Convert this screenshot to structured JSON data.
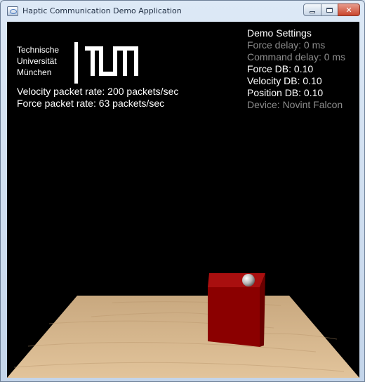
{
  "window": {
    "title": "Haptic Communication Demo Application"
  },
  "logo": {
    "line1": "Technische",
    "line2": "Universität",
    "line3": "München"
  },
  "status": {
    "velocity_rate": "Velocity packet rate: 200 packets/sec",
    "force_rate": "Force packet rate: 63 packets/sec"
  },
  "settings": {
    "heading": "Demo Settings",
    "force_delay": "Force delay: 0 ms",
    "command_delay": "Command delay: 0 ms",
    "force_db": "Force DB: 0.10",
    "velocity_db": "Velocity DB: 0.10",
    "position_db": "Position DB: 0.10",
    "device": "Device: Novint Falcon"
  },
  "colors": {
    "settings_active": "#ffffff",
    "settings_inactive": "#8c8c8c",
    "cube": "#8b0000",
    "floor": "#d8b68c"
  }
}
